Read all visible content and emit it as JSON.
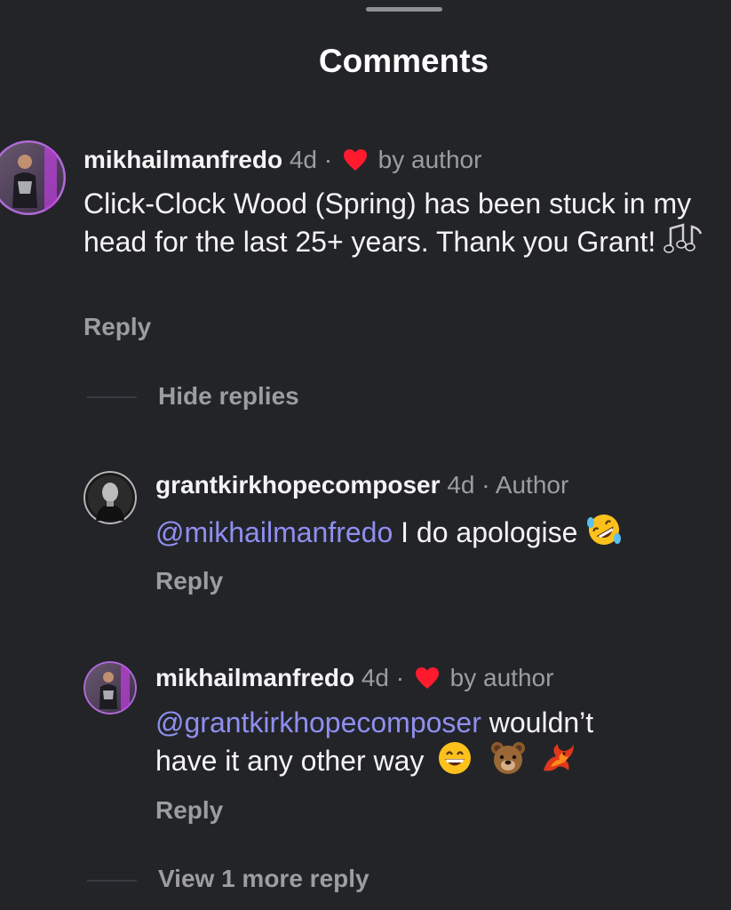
{
  "sheet": {
    "title": "Comments"
  },
  "comments": [
    {
      "username": "mikhailmanfredo",
      "age": "4d",
      "separator": "·",
      "liked_by_author_label": "by author",
      "text": "Click-Clock Wood (Spring) has been stuck in my head for the last 25+ years. Thank you Grant!",
      "emoji": "musical-notes",
      "reply_label": "Reply"
    }
  ],
  "thread": {
    "hide_replies_label": "Hide replies",
    "replies": [
      {
        "username": "grantkirkhopecomposer",
        "age": "4d",
        "separator": "·",
        "role": "Author",
        "mention": "@mikhailmanfredo",
        "text": " I do apologise",
        "emoji": "rolling-on-floor-laughing",
        "reply_label": "Reply"
      },
      {
        "username": "mikhailmanfredo",
        "age": "4d",
        "separator": "·",
        "liked_by_author_label": "by author",
        "mention": "@grantkirkhopecomposer",
        "text_line1": " wouldn’t",
        "text_line2": "have it any other way",
        "emojis": [
          "grinning-face",
          "bear-face",
          "phoenix"
        ],
        "reply_label": "Reply"
      }
    ],
    "view_more_label": "View 1 more reply"
  },
  "colors": {
    "background": "#232428",
    "text": "#f4f4f4",
    "muted": "#9c9da1",
    "mention": "#8f8ff0",
    "heart": "#ff1a2e"
  }
}
